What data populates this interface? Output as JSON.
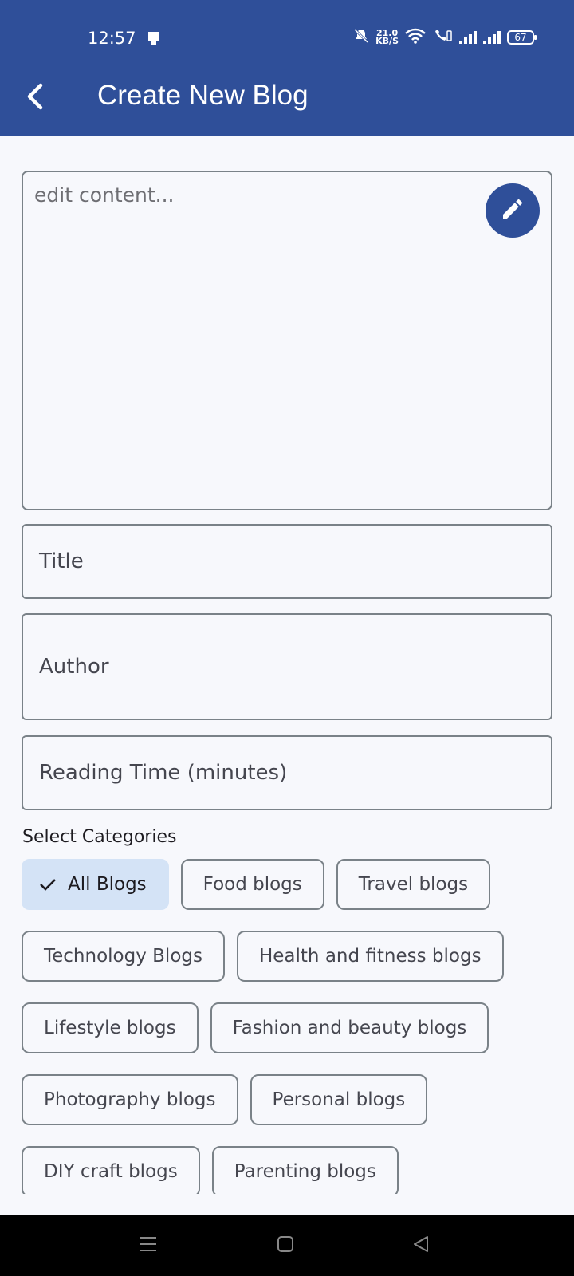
{
  "status_bar": {
    "time": "12:57",
    "net_speed_value": "21.0",
    "net_speed_unit": "KB/S",
    "battery": "67"
  },
  "header": {
    "title": "Create New Blog"
  },
  "form": {
    "content_placeholder": "edit content...",
    "title_placeholder": "Title",
    "author_placeholder": "Author",
    "reading_time_placeholder": "Reading Time (minutes)"
  },
  "categories": {
    "label": "Select Categories",
    "chips": [
      {
        "label": "All Blogs",
        "selected": true
      },
      {
        "label": "Food blogs",
        "selected": false
      },
      {
        "label": "Travel blogs",
        "selected": false
      },
      {
        "label": "Technology Blogs",
        "selected": false
      },
      {
        "label": "Health and fitness blogs",
        "selected": false
      },
      {
        "label": "Lifestyle blogs",
        "selected": false
      },
      {
        "label": "Fashion and beauty blogs",
        "selected": false
      },
      {
        "label": "Photography blogs",
        "selected": false
      },
      {
        "label": "Personal blogs",
        "selected": false
      },
      {
        "label": "DIY craft blogs",
        "selected": false
      },
      {
        "label": "Parenting blogs",
        "selected": false
      }
    ]
  },
  "colors": {
    "primary": "#2f4f99",
    "selected_chip": "#d4e3f6",
    "outline": "#7a8288",
    "background": "#f7f8fc"
  },
  "icons": {
    "back": "arrow-back-icon",
    "edit": "pencil-icon",
    "check": "check-icon",
    "nav_recents": "menu-lines-icon",
    "nav_home": "square-icon",
    "nav_back": "triangle-back-icon"
  }
}
